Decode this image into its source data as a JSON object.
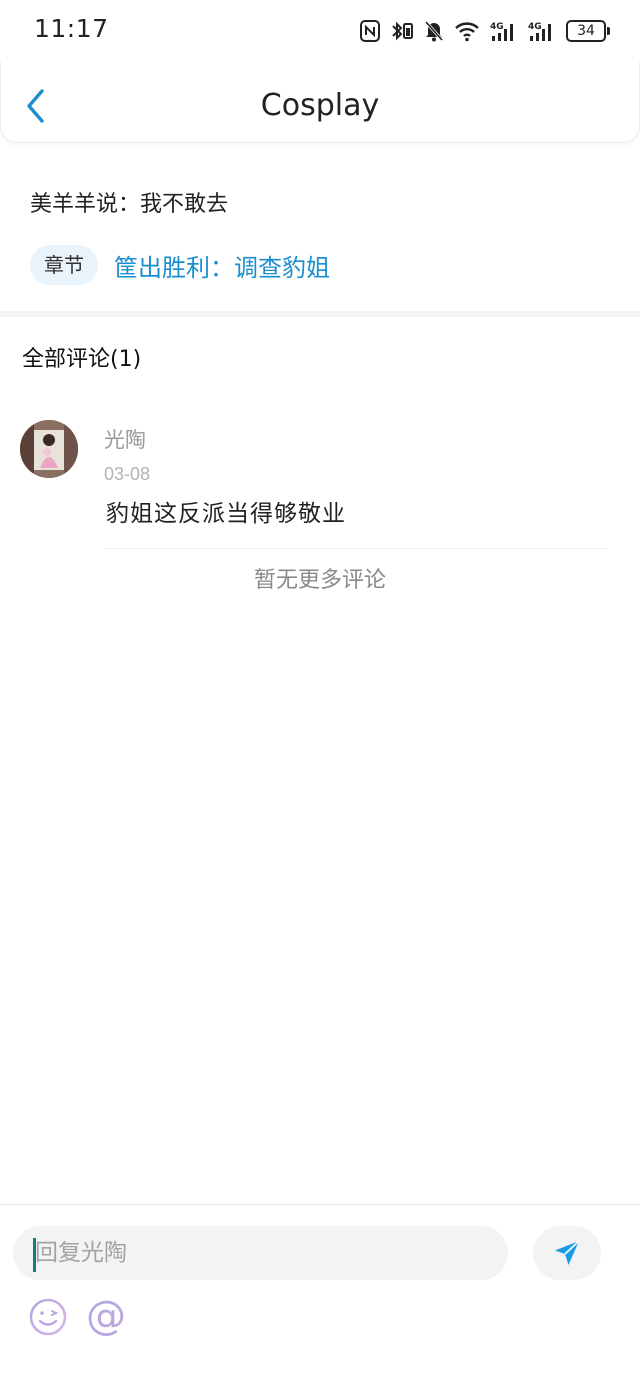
{
  "status_bar": {
    "time": "11:17",
    "battery": "34",
    "icons": [
      "nfc-icon",
      "bluetooth-icon",
      "mute-icon",
      "wifi-icon",
      "4g-signal-icon",
      "4g-signal-icon-2",
      "battery-icon"
    ]
  },
  "header": {
    "title": "Cosplay",
    "back_icon": "chevron-left-icon",
    "accent": "#1a8fcf"
  },
  "post": {
    "text": "美羊羊说：我不敢去",
    "chapter_badge": "章节",
    "chapter_link": "筐出胜利：调查豹姐"
  },
  "comments": {
    "title": "全部评论(1)",
    "items": [
      {
        "user": "光陶",
        "date": "03-08",
        "text": "豹姐这反派当得够敬业"
      }
    ],
    "no_more": "暂无更多评论"
  },
  "reply_bar": {
    "placeholder": "回复光陶",
    "send_icon": "send-icon",
    "emoji_icon": "emoji-icon",
    "mention_icon": "at-icon",
    "mention_glyph": "@"
  }
}
